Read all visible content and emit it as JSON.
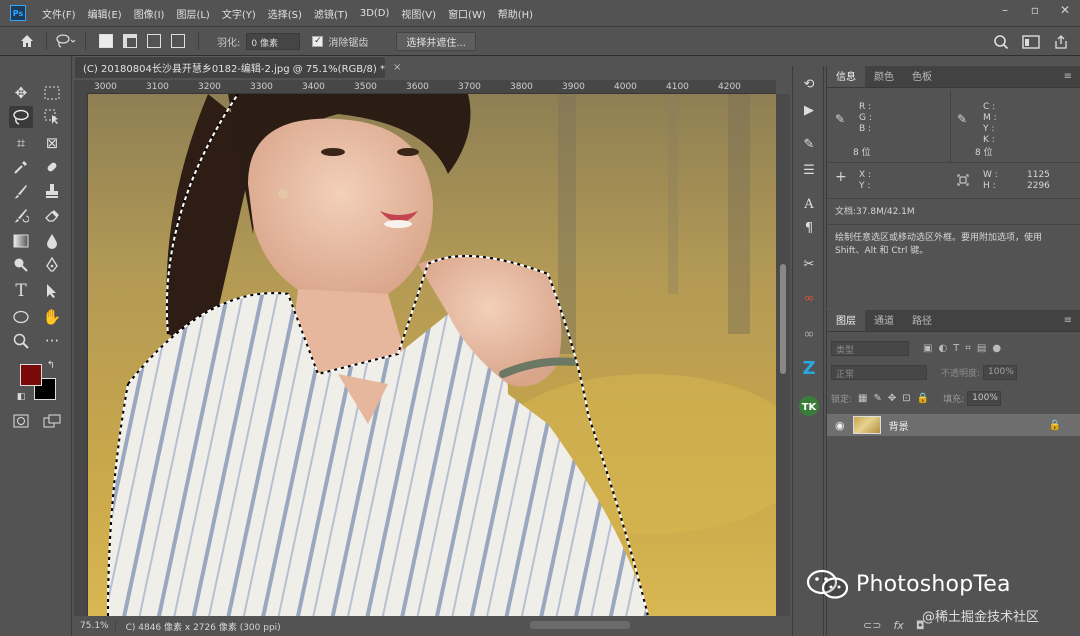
{
  "menubar": {
    "logo": "Ps",
    "items": [
      "文件(F)",
      "编辑(E)",
      "图像(I)",
      "图层(L)",
      "文字(Y)",
      "选择(S)",
      "滤镜(T)",
      "3D(D)",
      "视图(V)",
      "窗口(W)",
      "帮助(H)"
    ]
  },
  "options": {
    "feather_label": "羽化:",
    "feather_value": "0 像素",
    "antialias_label": "消除锯齿",
    "select_mask_label": "选择并遮住..."
  },
  "colors": {
    "foreground": "#7a0a0a",
    "background": "#000000",
    "accent": "#31a8ff",
    "panel_bg": "#535353"
  },
  "document": {
    "tab_title": "(C) 20180804长沙县开慧乡0182-编辑-2.jpg @ 75.1%(RGB/8) *",
    "close_glyph": "×",
    "ruler_labels": [
      "3000",
      "3100",
      "3200",
      "3300",
      "3400",
      "3500",
      "3600",
      "3700",
      "3800",
      "3900",
      "4000",
      "4100",
      "4200"
    ],
    "zoom": "75.1%",
    "status_info": "C) 4846 像素 x 2726 像素 (300 ppi)"
  },
  "info_panel": {
    "tabs": [
      "信息",
      "颜色",
      "色板"
    ],
    "rgb_labels": "R :\nG :\nB :",
    "rgb_bits": "8 位",
    "cmyk_labels": "C :\nM :\nY :\nK :",
    "cmyk_bits": "8 位",
    "xy_labels": "X :\nY :",
    "w_label": "W :",
    "h_label": "H :",
    "w_value": "1125",
    "h_value": "2296",
    "doc_size": "文档:37.8M/42.1M",
    "hint": "绘制任意选区或移动选区外框。要用附加选项，使用 Shift、Alt 和 Ctrl 键。"
  },
  "layers_panel": {
    "tabs": [
      "图层",
      "通道",
      "路径"
    ],
    "search_placeholder": "类型",
    "blend_mode": "正常",
    "opacity_label": "不透明度:",
    "opacity_value": "100%",
    "lock_label": "锁定:",
    "fill_label": "填充:",
    "fill_value": "100%",
    "layer_name": "背景"
  },
  "watermark": {
    "brand": "PhotoshopTea",
    "secondary": "@稀土掘金技术社区"
  }
}
